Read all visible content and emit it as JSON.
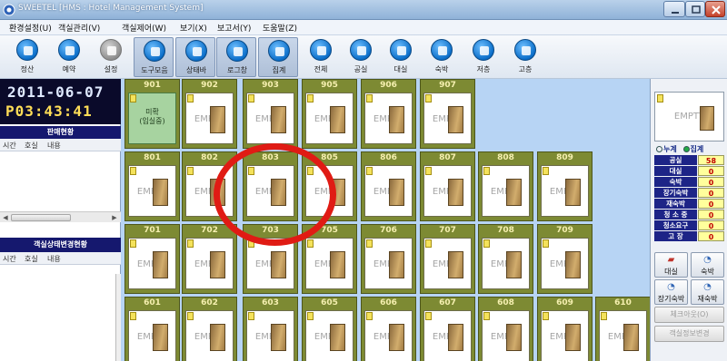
{
  "window": {
    "title": "SWEETEL  [HMS : Hotel Management System]"
  },
  "menu": [
    "환경설정(U)",
    "객실관리(V)",
    "객실제어(W)",
    "보기(X)",
    "보고서(Y)",
    "도움말(Z)"
  ],
  "toolbar": [
    {
      "label": "정산",
      "icon": "settlement-icon"
    },
    {
      "label": "예약",
      "icon": "reservation-icon"
    },
    {
      "label": "설정",
      "icon": "settings-icon"
    },
    {
      "label": "도구모음",
      "icon": "tools-icon"
    },
    {
      "label": "상태바",
      "icon": "statusbar-icon"
    },
    {
      "label": "로그창",
      "icon": "log-icon"
    },
    {
      "label": "집계",
      "icon": "tally-icon"
    },
    {
      "label": "전체",
      "icon": "all-icon"
    },
    {
      "label": "공실",
      "icon": "vacant-icon"
    },
    {
      "label": "대실",
      "icon": "short-stay-icon"
    },
    {
      "label": "숙박",
      "icon": "stay-icon"
    },
    {
      "label": "저층",
      "icon": "low-floor-icon"
    },
    {
      "label": "고층",
      "icon": "high-floor-icon"
    }
  ],
  "clock": {
    "date": "2011-06-07",
    "time": "P03:43:41"
  },
  "left_panel": {
    "top_title": "판매현황",
    "bottom_title": "객실상태변경현황",
    "columns": [
      "시간",
      "호실",
      "내용"
    ]
  },
  "rooms": {
    "empty_label": "EMPTY",
    "occupied_label": "미확\n(입실중)",
    "floors": [
      [
        "901",
        "902",
        "903",
        "905",
        "906",
        "907"
      ],
      [
        "801",
        "802",
        "803",
        "805",
        "806",
        "807",
        "808",
        "809"
      ],
      [
        "701",
        "702",
        "703",
        "705",
        "706",
        "707",
        "708",
        "709"
      ],
      [
        "601",
        "602",
        "603",
        "605",
        "606",
        "607",
        "608",
        "609",
        "610"
      ]
    ],
    "occupied": [
      "901"
    ]
  },
  "right_panel": {
    "preview_label": "EMPTY",
    "mode": {
      "option1": "누계",
      "option2": "집계",
      "selected": "집계"
    },
    "stats": [
      {
        "label": "공실",
        "value": "58"
      },
      {
        "label": "대실",
        "value": "0"
      },
      {
        "label": "숙박",
        "value": "0"
      },
      {
        "label": "장기숙박",
        "value": "0"
      },
      {
        "label": "재숙박",
        "value": "0"
      },
      {
        "label": "청 소 중",
        "value": "0"
      },
      {
        "label": "청소요구",
        "value": "0"
      },
      {
        "label": "고 장",
        "value": "0"
      }
    ],
    "buttons": [
      "대실",
      "숙박",
      "장기숙박",
      "재숙박"
    ],
    "checkout": "체크아웃(O)",
    "room_info": "객실정보변경"
  },
  "annotation_color": "#e01b14"
}
